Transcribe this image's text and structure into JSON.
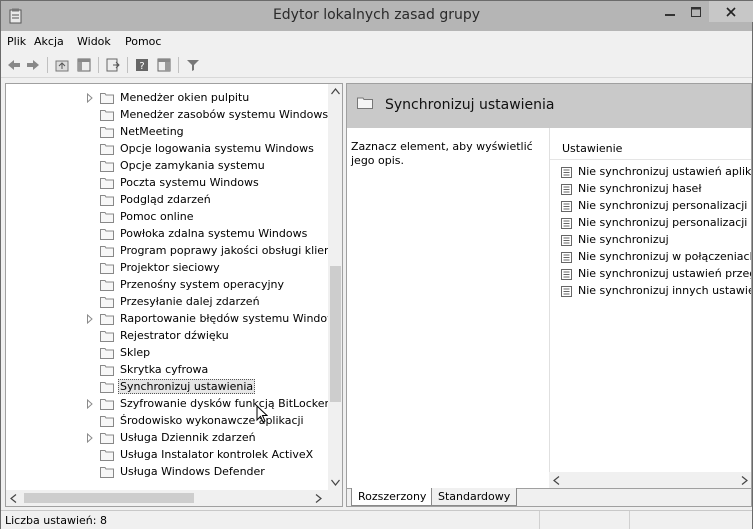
{
  "window": {
    "title": "Edytor lokalnych zasad grupy"
  },
  "menu": [
    "Plik",
    "Akcja",
    "Widok",
    "Pomoc"
  ],
  "tree": {
    "items": [
      {
        "label": "Menedżer okien pulpitu",
        "expandable": true
      },
      {
        "label": "Menedżer zasobów systemu Windows",
        "expandable": false
      },
      {
        "label": "NetMeeting",
        "expandable": false
      },
      {
        "label": "Opcje logowania systemu Windows",
        "expandable": false
      },
      {
        "label": "Opcje zamykania systemu",
        "expandable": false
      },
      {
        "label": "Poczta systemu Windows",
        "expandable": false
      },
      {
        "label": "Podgląd zdarzeń",
        "expandable": false
      },
      {
        "label": "Pomoc online",
        "expandable": false
      },
      {
        "label": "Powłoka zdalna systemu Windows",
        "expandable": false
      },
      {
        "label": "Program poprawy jakości obsługi klienta",
        "expandable": false
      },
      {
        "label": "Projektor sieciowy",
        "expandable": false
      },
      {
        "label": "Przenośny system operacyjny",
        "expandable": false
      },
      {
        "label": "Przesyłanie dalej zdarzeń",
        "expandable": false
      },
      {
        "label": "Raportowanie błędów systemu Windows",
        "expandable": true
      },
      {
        "label": "Rejestrator dźwięku",
        "expandable": false
      },
      {
        "label": "Sklep",
        "expandable": false
      },
      {
        "label": "Skrytka cyfrowa",
        "expandable": false
      },
      {
        "label": "Synchronizuj ustawienia",
        "expandable": false,
        "selected": true
      },
      {
        "label": "Szyfrowanie dysków funkcją BitLocker",
        "expandable": true
      },
      {
        "label": "Środowisko wykonawcze aplikacji",
        "expandable": false
      },
      {
        "label": "Usługa Dziennik zdarzeń",
        "expandable": true
      },
      {
        "label": "Usługa Instalator kontrolek ActiveX",
        "expandable": false
      },
      {
        "label": "Usługa Windows Defender",
        "expandable": false
      }
    ]
  },
  "details": {
    "header_title": "Synchronizuj ustawienia",
    "description": "Zaznacz element, aby wyświetlić jego opis.",
    "column_header": "Ustawienie",
    "settings": [
      "Nie synchronizuj ustawień aplikacji",
      "Nie synchronizuj haseł",
      "Nie synchronizuj personalizacji pulpitu",
      "Nie synchronizuj personalizacji",
      "Nie synchronizuj",
      "Nie synchronizuj w połączeniach taryfowych",
      "Nie synchronizuj ustawień przeglądarki",
      "Nie synchronizuj innych ustawień systemu Windows"
    ],
    "tabs": [
      "Rozszerzony",
      "Standardowy"
    ]
  },
  "status": {
    "text": "Liczba ustawień: 8"
  }
}
